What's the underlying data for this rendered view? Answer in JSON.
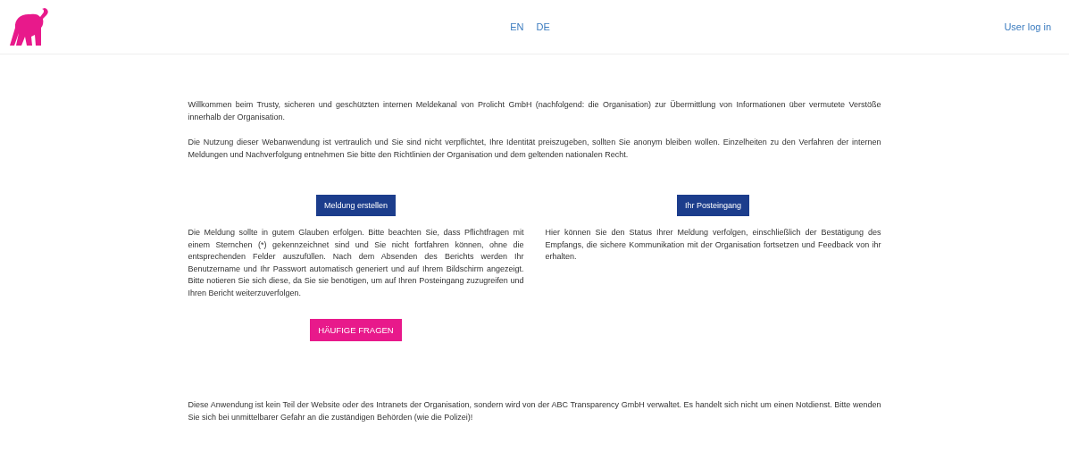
{
  "header": {
    "languages": [
      {
        "label": "EN"
      },
      {
        "label": "DE"
      }
    ],
    "login_link": "User log in"
  },
  "intro": [
    "Willkommen beim Trusty, sicheren und geschützten internen Meldekanal von Prolicht GmbH (nachfolgend: die Organisation) zur Übermittlung von Informationen über vermutete Verstöße innerhalb der Organisation.",
    "Die Nutzung dieser Webanwendung ist vertraulich und Sie sind nicht verpflichtet, Ihre Identität preiszugeben, sollten Sie anonym bleiben wollen. Einzelheiten zu den Verfahren der internen Meldungen und Nachverfolgung entnehmen Sie bitte den Richtlinien der Organisation und dem geltenden nationalen Recht."
  ],
  "columns": [
    {
      "button": "Meldung erstellen",
      "text": "Die Meldung sollte in gutem Glauben erfolgen. Bitte beachten Sie, dass Pflichtfragen mit einem Sternchen (*) gekennzeichnet sind und Sie nicht fortfahren können, ohne die entsprechenden Felder auszufüllen. Nach dem Absenden des Berichts werden Ihr Benutzername und Ihr Passwort automatisch generiert und auf Ihrem Bildschirm angezeigt. Bitte notieren Sie sich diese, da Sie sie benötigen, um auf Ihren Posteingang zuzugreifen und Ihren Bericht weiterzuverfolgen."
    },
    {
      "button": "Ihr Posteingang",
      "text": "Hier können Sie den Status Ihrer Meldung verfolgen, einschließlich der Bestätigung des Empfangs, die sichere Kommunikation mit der Organisation fortsetzen und Feedback von ihr erhalten."
    }
  ],
  "faq_button": "HÄUFIGE FRAGEN",
  "footer": "Diese Anwendung ist kein Teil der Website oder des Intranets der Organisation, sondern wird von der ABC Transparency GmbH verwaltet. Es handelt sich nicht um einen Notdienst. Bitte wenden Sie sich bei unmittelbarer Gefahr an die zuständigen Behörden (wie die Polizei)!"
}
